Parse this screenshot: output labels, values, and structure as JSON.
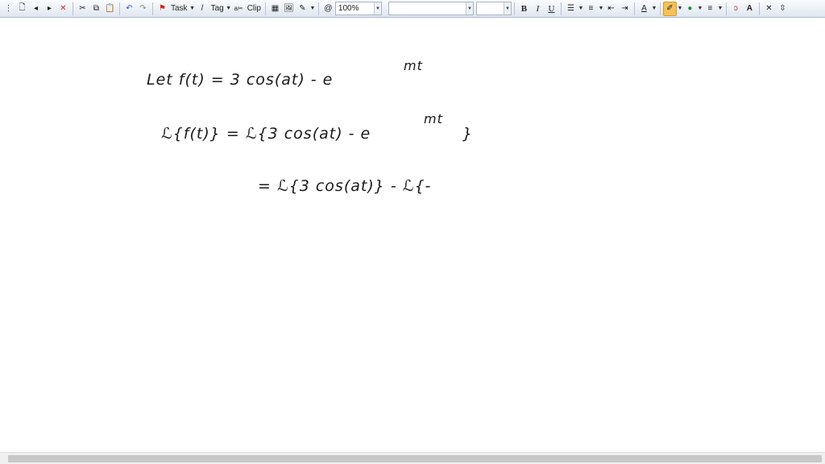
{
  "toolbar": {
    "task_label": "Task",
    "tag_label": "Tag",
    "clip_label": "Clip",
    "zoom_value": "100%",
    "font_value": "",
    "font_size_value": "",
    "bold_label": "B",
    "italic_label": "I",
    "underline_label": "U",
    "font_color_label": "A",
    "clear_format_label": "A"
  },
  "note": {
    "line1": "Let  f(t) = 3 cos(at) - e",
    "line1_sup": "mt",
    "line2": "ℒ{f(t)} = ℒ{3 cos(at) - e",
    "line2_sup": "mt",
    "line2_end": "}",
    "line3": "= ℒ{3 cos(at)} - ℒ{-"
  },
  "colors": {
    "ink": "#1a1a1a",
    "highlight": "#f4c25a",
    "toolbar_bg": "#dfe6f1"
  }
}
